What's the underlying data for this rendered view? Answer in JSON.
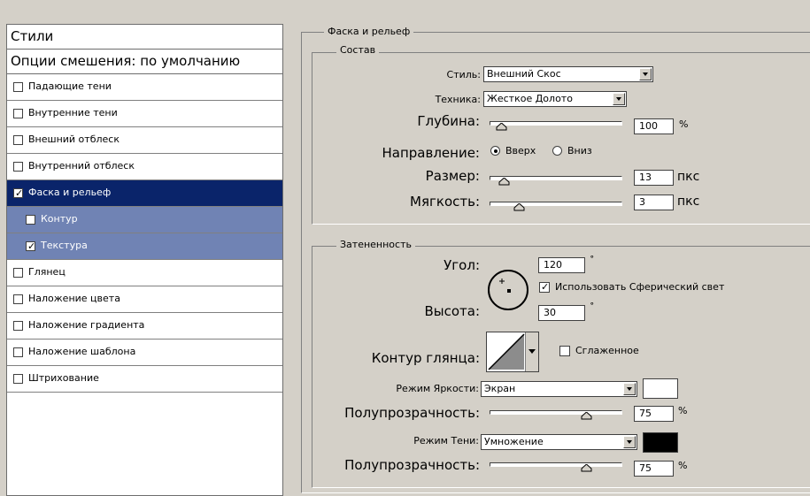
{
  "styles_list": {
    "header": "Стили",
    "blend_options": "Опции смешения: по умолчанию",
    "items": [
      {
        "label": "Падающие тени",
        "checked": false,
        "state": "normal"
      },
      {
        "label": "Внутренние тени",
        "checked": false,
        "state": "normal"
      },
      {
        "label": "Внешний отблеск",
        "checked": false,
        "state": "normal"
      },
      {
        "label": "Внутренний отблеск",
        "checked": false,
        "state": "normal"
      },
      {
        "label": "Фаска и рельеф",
        "checked": true,
        "state": "selected"
      },
      {
        "label": "Контур",
        "checked": false,
        "state": "sub"
      },
      {
        "label": "Текстура",
        "checked": true,
        "state": "sub"
      },
      {
        "label": "Глянец",
        "checked": false,
        "state": "normal"
      },
      {
        "label": "Наложение цвета",
        "checked": false,
        "state": "normal"
      },
      {
        "label": "Наложение градиента",
        "checked": false,
        "state": "normal"
      },
      {
        "label": "Наложение шаблона",
        "checked": false,
        "state": "normal"
      },
      {
        "label": "Штрихование",
        "checked": false,
        "state": "normal"
      }
    ]
  },
  "bevel": {
    "group_title": "Фаска и рельеф",
    "structure": {
      "title": "Состав",
      "style_label": "Стиль:",
      "style_value": "Внешний Скос",
      "technique_label": "Техника:",
      "technique_value": "Жесткое Долото",
      "depth_label": "Глубина:",
      "depth_value": "100",
      "depth_unit": "%",
      "depth_fraction": 0.05,
      "direction_label": "Направление:",
      "direction_up": "Вверх",
      "direction_down": "Вниз",
      "direction_selected": "up",
      "size_label": "Размер:",
      "size_value": "13",
      "size_unit": "пкс",
      "size_fraction": 0.07,
      "soften_label": "Мягкость:",
      "soften_value": "3",
      "soften_unit": "пкс",
      "soften_fraction": 0.2
    },
    "shading": {
      "title": "Затененность",
      "angle_label": "Угол:",
      "angle_value": "120",
      "angle_unit": "˚",
      "global_light_label": "Использовать Сферический свет",
      "global_light_checked": true,
      "altitude_label": "Высота:",
      "altitude_value": "30",
      "altitude_unit": "˚",
      "gloss_contour_label": "Контур глянца:",
      "anti_aliased_label": "Сглаженное",
      "anti_aliased_checked": false,
      "highlight_mode_label": "Режим Яркости:",
      "highlight_mode_value": "Экран",
      "highlight_color": "#ffffff",
      "highlight_opacity_label": "Полупрозрачность:",
      "highlight_opacity_value": "75",
      "highlight_opacity_unit": "%",
      "highlight_opacity_fraction": 0.75,
      "shadow_mode_label": "Режим Тени:",
      "shadow_mode_value": "Умножение",
      "shadow_color": "#000000",
      "shadow_opacity_label": "Полупрозрачность:",
      "shadow_opacity_value": "75",
      "shadow_opacity_unit": "%",
      "shadow_opacity_fraction": 0.75
    }
  },
  "colors": {
    "selected_row": "#0a246a",
    "sub_row": "#7083b4",
    "dialog_bg": "#d4d0c8"
  }
}
